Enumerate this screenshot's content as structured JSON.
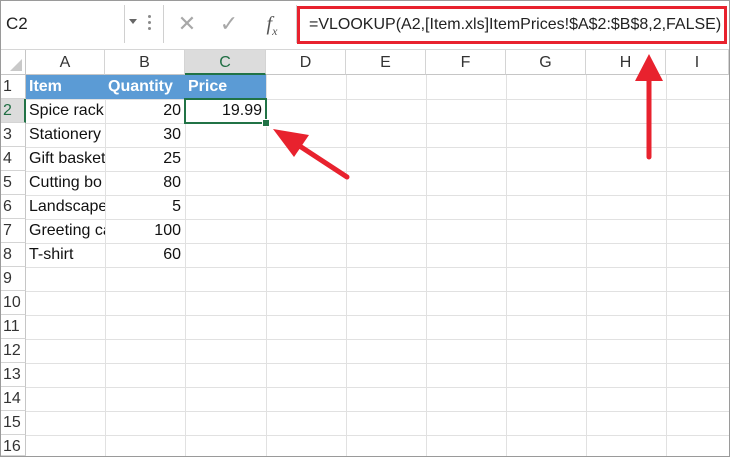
{
  "formula_bar": {
    "name_box": "C2",
    "cancel_glyph": "✕",
    "enter_glyph": "✓",
    "fx_label": "f",
    "fx_sub": "x",
    "formula": "=VLOOKUP(A2,[Item.xls]ItemPrices!$A$2:$B$8,2,FALSE)"
  },
  "columns": [
    "A",
    "B",
    "C",
    "D",
    "E",
    "F",
    "G",
    "H",
    "I"
  ],
  "selected_column": "C",
  "rows": [
    "1",
    "2",
    "3",
    "4",
    "5",
    "6",
    "7",
    "8",
    "9",
    "10",
    "11",
    "12",
    "13",
    "14",
    "15",
    "16"
  ],
  "selected_row": "2",
  "table": {
    "headers": [
      "Item",
      "Quantity",
      "Price"
    ],
    "rows": [
      {
        "item": "Spice rack",
        "quantity": "20",
        "price": "19.99"
      },
      {
        "item": "Stationery",
        "quantity": "30",
        "price": ""
      },
      {
        "item": "Gift basket",
        "quantity": "25",
        "price": ""
      },
      {
        "item": "Cutting bo",
        "quantity": "80",
        "price": ""
      },
      {
        "item": "Landscape",
        "quantity": "5",
        "price": ""
      },
      {
        "item": "Greeting ca",
        "quantity": "100",
        "price": ""
      },
      {
        "item": "T-shirt",
        "quantity": "60",
        "price": ""
      }
    ]
  },
  "colors": {
    "header_fill": "#5b9bd5",
    "selection": "#217346",
    "annotation": "#e8222e"
  }
}
